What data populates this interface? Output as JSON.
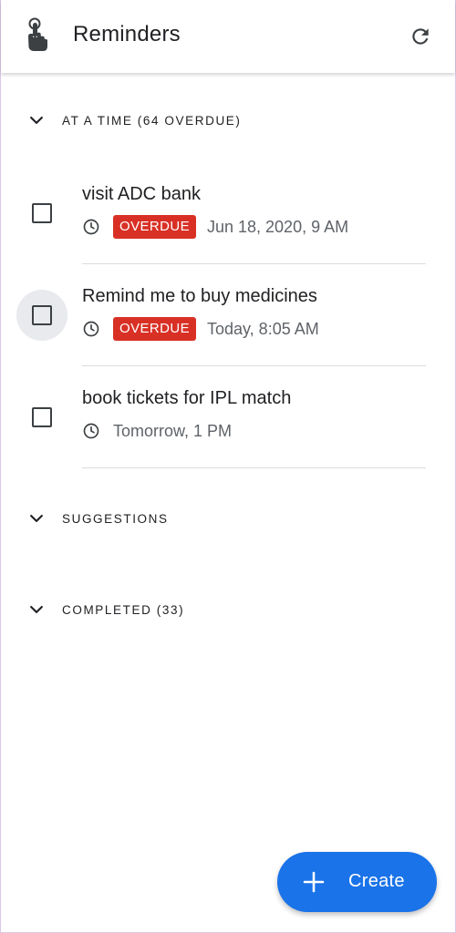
{
  "app": {
    "title": "Reminders",
    "icon": "hand-pointer-icon",
    "refresh_icon": "refresh-icon"
  },
  "sections": {
    "at_a_time": {
      "label": "AT A TIME (64 OVERDUE)"
    },
    "suggestions": {
      "label": "SUGGESTIONS"
    },
    "completed": {
      "label": "COMPLETED (33)"
    }
  },
  "reminders": [
    {
      "title": "visit ADC bank",
      "badge": "OVERDUE",
      "time": "Jun 18, 2020, 9 AM"
    },
    {
      "title": "Remind me to buy medicines",
      "badge": "OVERDUE",
      "time": "Today, 8:05 AM"
    },
    {
      "title": "book tickets for IPL match",
      "badge": "",
      "time": "Tomorrow, 1 PM"
    }
  ],
  "fab": {
    "label": "Create",
    "icon": "plus-icon"
  },
  "colors": {
    "accent": "#1a73e8",
    "overdue": "#d93025",
    "text": "#202124",
    "secondary_text": "#5f6368"
  }
}
